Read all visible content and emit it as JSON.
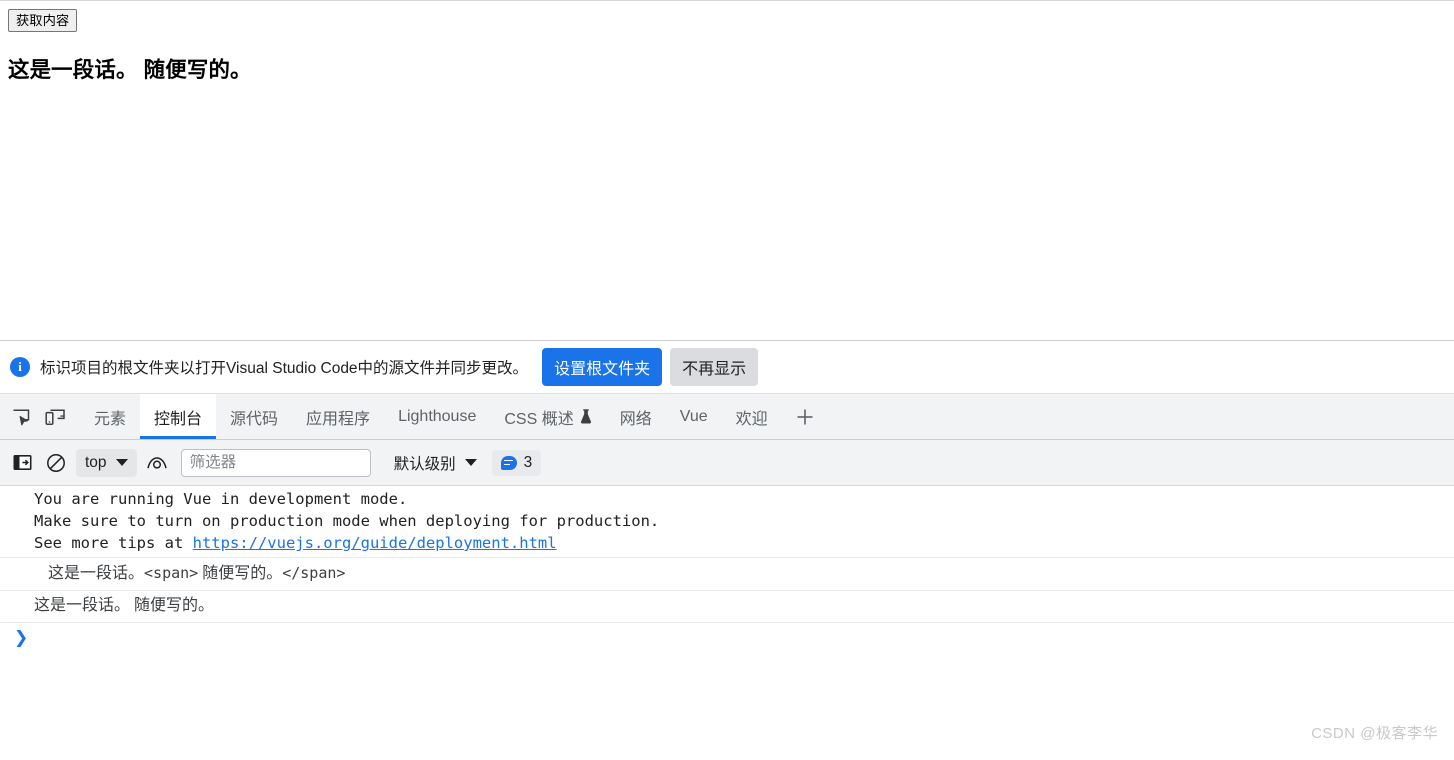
{
  "page": {
    "fetch_button_label": "获取内容",
    "heading_text": "这是一段话。 随便写的。"
  },
  "notice": {
    "icon": "info-icon",
    "icon_glyph": "i",
    "message": "标识项目的根文件夹以打开Visual Studio Code中的源文件并同步更改。",
    "primary_button": "设置根文件夹",
    "secondary_button": "不再显示",
    "primary_color": "#1a73e8",
    "secondary_color": "#dadce0"
  },
  "devtools": {
    "inspect_icon": "inspect-element-icon",
    "device_icon": "device-toolbar-icon",
    "tabs": [
      {
        "label": "元素",
        "active": false,
        "flask": false
      },
      {
        "label": "控制台",
        "active": true,
        "flask": false
      },
      {
        "label": "源代码",
        "active": false,
        "flask": false
      },
      {
        "label": "应用程序",
        "active": false,
        "flask": false
      },
      {
        "label": "Lighthouse",
        "active": false,
        "flask": false
      },
      {
        "label": "CSS 概述",
        "active": false,
        "flask": true
      },
      {
        "label": "网络",
        "active": false,
        "flask": false
      },
      {
        "label": "Vue",
        "active": false,
        "flask": false
      },
      {
        "label": "欢迎",
        "active": false,
        "flask": false
      }
    ],
    "add_tab_icon": "plus-icon",
    "active_tab_accent": "#1a73e8"
  },
  "console_toolbar": {
    "sidebar_icon": "console-sidebar-icon",
    "clear_icon": "clear-console-icon",
    "context_value": "top",
    "eye_icon": "live-expression-eye-icon",
    "filter_placeholder": "筛选器",
    "filter_value": "",
    "level_value": "默认级别",
    "message_count": "3",
    "message_icon": "speech-bubble-icon"
  },
  "console": {
    "messages": [
      {
        "type": "mono",
        "indent": false,
        "lines": [
          {
            "text": "You are running Vue in development mode."
          },
          {
            "text": "Make sure to turn on production mode when deploying for production."
          },
          {
            "text": "See more tips at ",
            "link": "https://vuejs.org/guide/deployment.html"
          }
        ]
      },
      {
        "type": "cjk",
        "indent": true,
        "prefix": "这是一段话。",
        "tag_open": "<span>",
        "middle": " 随便写的。",
        "tag_close": "</span>"
      },
      {
        "type": "cjk",
        "indent": false,
        "text": "这是一段话。 随便写的。"
      }
    ],
    "prompt_glyph": "❯"
  },
  "watermark": {
    "text": "CSDN @极客李华"
  }
}
